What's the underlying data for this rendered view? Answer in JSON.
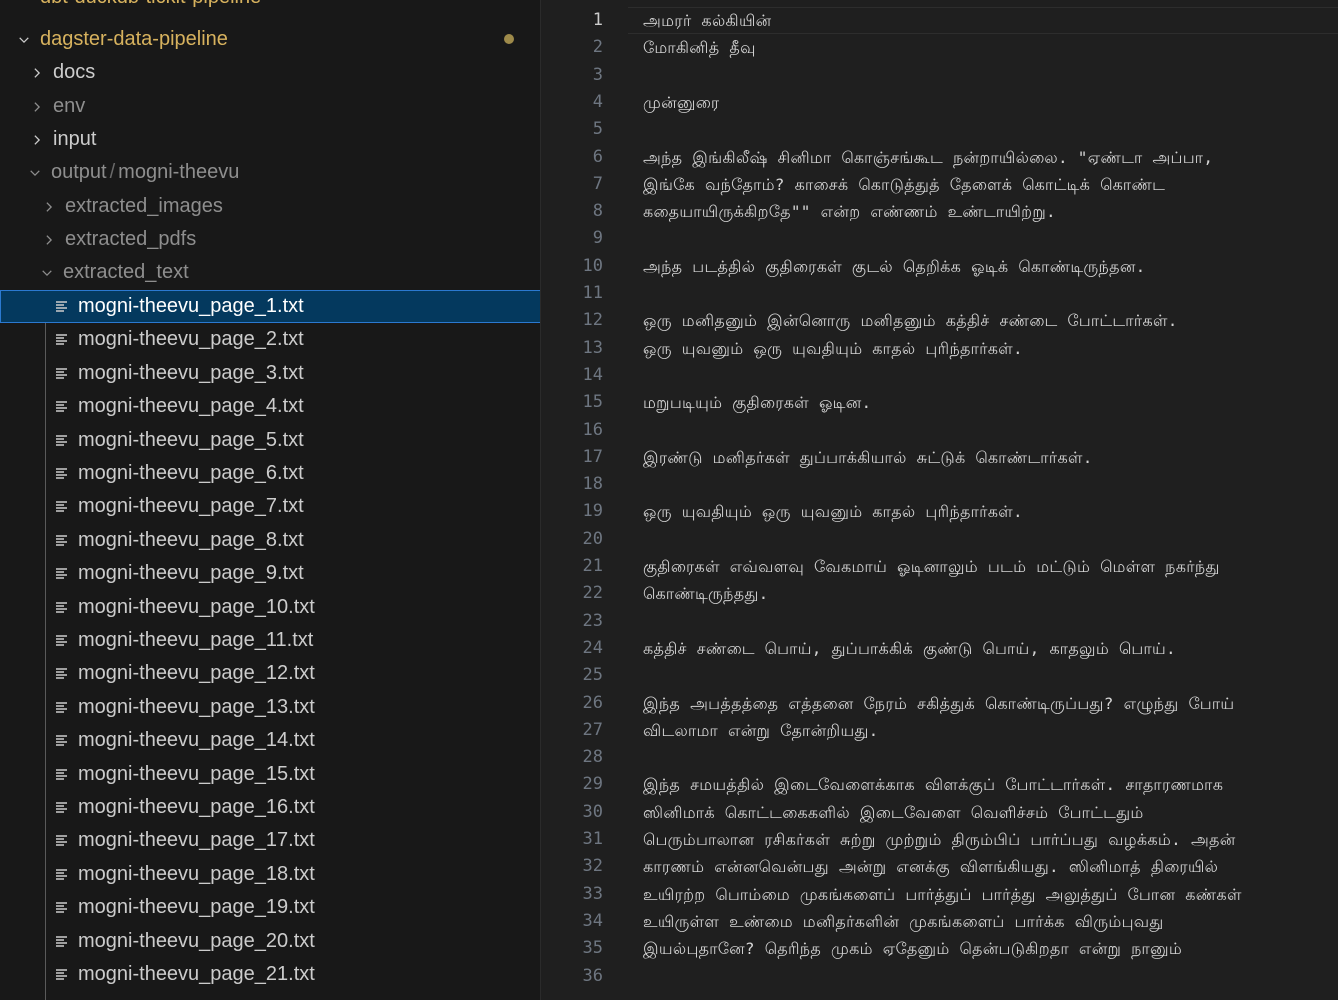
{
  "explorer": {
    "partial_top_item": "dbt-duckdb-tickit-pipeline",
    "root_folder": "dagster-data-pipeline",
    "folders": {
      "docs": "docs",
      "env": "env",
      "input": "input",
      "output": "output",
      "output_sub": "mogni-theevu",
      "output_sep": "/",
      "extracted_images": "extracted_images",
      "extracted_pdfs": "extracted_pdfs",
      "extracted_text": "extracted_text"
    },
    "files": [
      "mogni-theevu_page_1.txt",
      "mogni-theevu_page_2.txt",
      "mogni-theevu_page_3.txt",
      "mogni-theevu_page_4.txt",
      "mogni-theevu_page_5.txt",
      "mogni-theevu_page_6.txt",
      "mogni-theevu_page_7.txt",
      "mogni-theevu_page_8.txt",
      "mogni-theevu_page_9.txt",
      "mogni-theevu_page_10.txt",
      "mogni-theevu_page_11.txt",
      "mogni-theevu_page_12.txt",
      "mogni-theevu_page_13.txt",
      "mogni-theevu_page_14.txt",
      "mogni-theevu_page_15.txt",
      "mogni-theevu_page_16.txt",
      "mogni-theevu_page_17.txt",
      "mogni-theevu_page_18.txt",
      "mogni-theevu_page_19.txt",
      "mogni-theevu_page_20.txt",
      "mogni-theevu_page_21.txt"
    ],
    "selected_file_index": 0
  },
  "editor": {
    "active_line": 1,
    "lines": [
      "அமரர் கல்கியின்",
      "மோகினித் தீவு",
      "",
      "முன்னுரை",
      "",
      "அந்த இங்கிலீஷ் சினிமா கொஞ்சங்கூட நன்றாயில்லை. \"ஏண்டா அப்பா,",
      "இங்கே வந்தோம்? காசைக் கொடுத்துத் தேளைக் கொட்டிக் கொண்ட",
      "கதையாயிருக்கிறதே\"\" என்ற எண்ணம் உண்டாயிற்று.",
      "",
      "அந்த படத்தில் குதிரைகள் குடல் தெறிக்க ஓடிக் கொண்டிருந்தன.",
      "",
      "ஒரு மனிதனும் இன்னொரு மனிதனும் கத்திச் சண்டை போட்டார்கள்.",
      "ஒரு யுவனும் ஒரு யுவதியும் காதல் புரிந்தார்கள்.",
      "",
      "மறுபடியும் குதிரைகள் ஓடின.",
      "",
      "இரண்டு மனிதர்கள் துப்பாக்கியால் சுட்டுக் கொண்டார்கள்.",
      "",
      "ஒரு யுவதியும் ஒரு யுவனும் காதல் புரிந்தார்கள்.",
      "",
      "குதிரைகள் எவ்வளவு வேகமாய் ஓடினாலும் படம் மட்டும் மெள்ள நகர்ந்து",
      "கொண்டிருந்தது.",
      "",
      "கத்திச் சண்டை பொய், துப்பாக்கிக் குண்டு பொய், காதலும் பொய்.",
      "",
      "இந்த அபத்தத்தை எத்தனை நேரம் சகித்துக் கொண்டிருப்பது? எழுந்து போய்",
      "விடலாமா என்று தோன்றியது.",
      "",
      "இந்த சமயத்தில் இடைவேளைக்காக விளக்குப் போட்டார்கள். சாதாரணமாக",
      "ஸினிமாக் கொட்டகைகளில் இடைவேளை வெளிச்சம் போட்டதும்",
      "பெரும்பாலான ரசிகர்கள் சுற்று முற்றும் திரும்பிப் பார்ப்பது வழக்கம். அதன்",
      "காரணம் என்னவென்பது அன்று எனக்கு விளங்கியது. ஸினிமாத் திரையில்",
      "உயிரற்ற பொம்மை முகங்களைப் பார்த்துப் பார்த்து அலுத்துப் போன கண்கள்",
      "உயிருள்ள உண்மை மனிதர்களின் முகங்களைப் பார்க்க விரும்புவது",
      "இயல்புதானே? தெரிந்த முகம் ஏதேனும் தென்படுகிறதா என்று நானும்",
      ""
    ]
  },
  "colors": {
    "selected_bg": "#04395e",
    "selected_border": "#2b79d0",
    "git_modified": "#d7b25e"
  }
}
